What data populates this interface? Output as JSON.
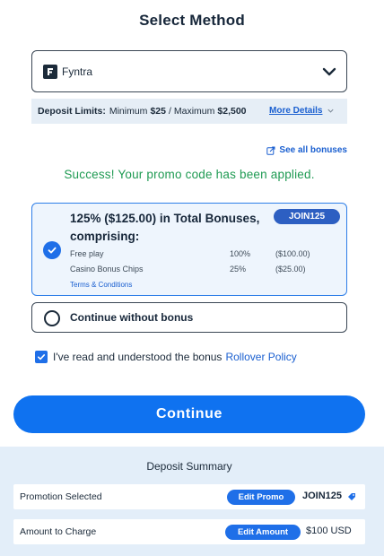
{
  "header": {
    "title": "Select Method"
  },
  "method": {
    "name": "Fyntra",
    "logo_icon": "fyntra-logo-icon",
    "dropdown_icon": "chevron-down-icon"
  },
  "limits": {
    "label": "Deposit Limits:",
    "min_text": "Minimum",
    "min_value": "$25",
    "separator": "/",
    "max_text": "Maximum",
    "max_value": "$2,500",
    "more_details": "More Details"
  },
  "bonuses_link": {
    "label": "See all bonuses",
    "icon": "external-link-icon"
  },
  "status": {
    "success_message": "Success! Your promo code has been applied.",
    "color": "#1e9a52"
  },
  "bonus_option": {
    "title": "125% ($125.00) in Total Bonuses, comprising:",
    "promo_code": "JOIN125",
    "selected": true,
    "rows": [
      {
        "name": "Free play",
        "percent": "100%",
        "amount": "($100.00)"
      },
      {
        "name": "Casino Bonus Chips",
        "percent": "25%",
        "amount": "($25.00)"
      }
    ],
    "terms_label": "Terms & Conditions"
  },
  "no_bonus_option": {
    "label": "Continue without bonus",
    "selected": false
  },
  "rollover": {
    "checked": true,
    "text": "I've read and understood the bonus",
    "link": "Rollover Policy"
  },
  "continue_button": {
    "label": "Continue"
  },
  "summary": {
    "title": "Deposit Summary",
    "promotion": {
      "label": "Promotion Selected",
      "button": "Edit Promo",
      "value": "JOIN125",
      "icon": "tag-icon"
    },
    "amount": {
      "label": "Amount to Charge",
      "button": "Edit Amount",
      "value": "$100 USD"
    }
  },
  "colors": {
    "accent": "#0f72f0",
    "link": "#1a5fd0",
    "badge": "#2d5fc2",
    "summary_bg": "#e3eef9"
  }
}
